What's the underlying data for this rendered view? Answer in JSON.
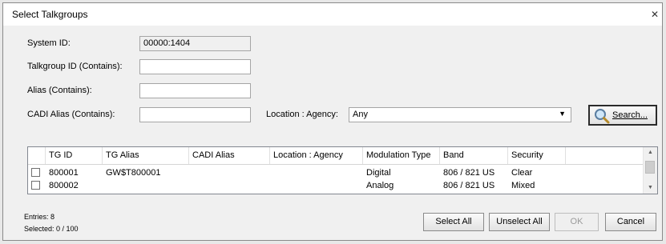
{
  "window": {
    "title": "Select Talkgroups",
    "close_glyph": "✕"
  },
  "form": {
    "system_id_label": "System ID:",
    "system_id_value": "00000:1404",
    "talkgroup_id_label": "Talkgroup ID (Contains):",
    "talkgroup_id_value": "",
    "alias_label": "Alias (Contains):",
    "alias_value": "",
    "cadi_alias_label": "CADI Alias (Contains):",
    "cadi_alias_value": "",
    "location_label": "Location : Agency:",
    "location_value": "Any",
    "search_button": "Search..."
  },
  "grid": {
    "columns": [
      "TG ID",
      "TG Alias",
      "CADI Alias",
      "Location : Agency",
      "Modulation Type",
      "Band",
      "Security"
    ],
    "rows": [
      {
        "checked": false,
        "tg_id": "800001",
        "tg_alias": "GW$T800001",
        "cadi_alias": "",
        "location": "",
        "modulation": "Digital",
        "band": "806 / 821 US",
        "security": "Clear"
      },
      {
        "checked": false,
        "tg_id": "800002",
        "tg_alias": "",
        "cadi_alias": "",
        "location": "",
        "modulation": "Analog",
        "band": "806 / 821 US",
        "security": "Mixed"
      }
    ]
  },
  "footer": {
    "entries": "Entries: 8",
    "selected": "Selected: 0 / 100",
    "select_all": "Select All",
    "unselect_all": "Unselect All",
    "ok": "OK",
    "cancel": "Cancel"
  }
}
